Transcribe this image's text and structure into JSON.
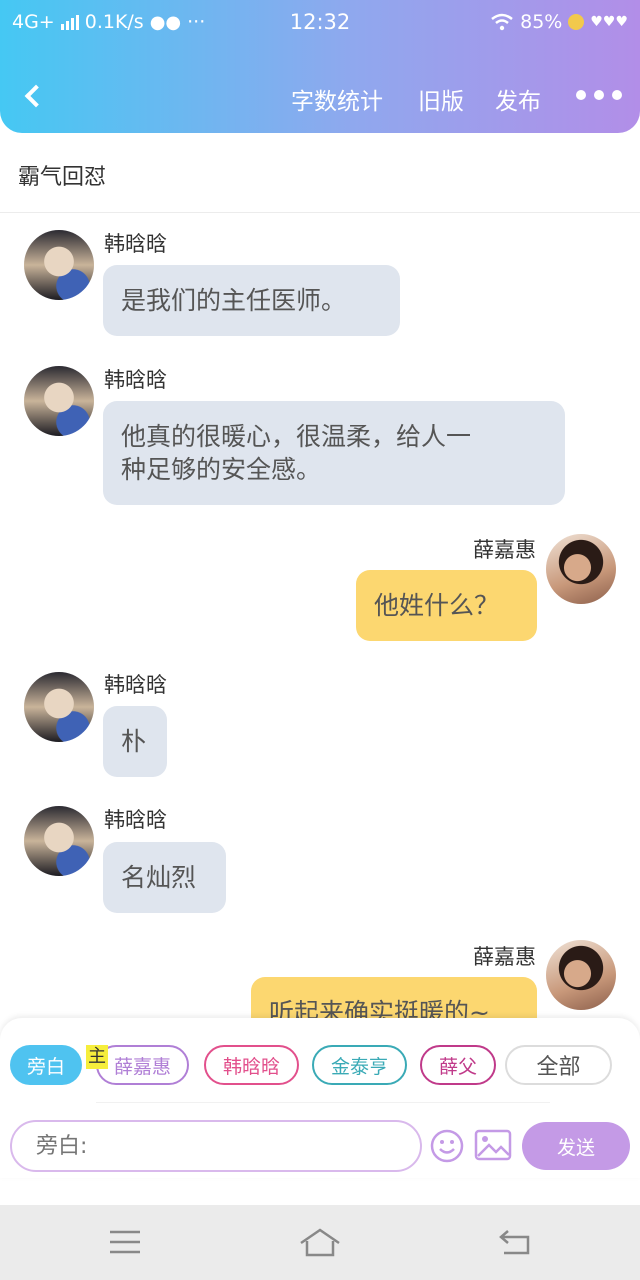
{
  "status_bar": {
    "network": "4G+",
    "speed": "0.1K/s",
    "time": "12:32",
    "battery": "85%"
  },
  "header": {
    "actions": [
      "字数统计",
      "旧版",
      "发布"
    ]
  },
  "title": "霸气回怼",
  "messages": [
    {
      "side": "left",
      "sender": "韩晗晗",
      "lines": [
        "是我们的主任医师。"
      ]
    },
    {
      "side": "left",
      "sender": "韩晗晗",
      "lines": [
        "他真的很暖心，很温柔，给人一",
        "种足够的安全感。"
      ]
    },
    {
      "side": "right",
      "sender": "薛嘉惠",
      "lines": [
        "他姓什么？"
      ]
    },
    {
      "side": "left",
      "sender": "韩晗晗",
      "lines": [
        "朴"
      ]
    },
    {
      "side": "left",
      "sender": "韩晗晗",
      "lines": [
        "名灿烈"
      ]
    },
    {
      "side": "right",
      "sender": "薛嘉惠",
      "lines": [
        "听起来确实挺暖的~"
      ]
    }
  ],
  "characters": {
    "narrator": "旁白",
    "main_badge": "主",
    "list": [
      {
        "name": "薛嘉惠",
        "color": "#b07fd6"
      },
      {
        "name": "韩晗晗",
        "color": "#e2508c"
      },
      {
        "name": "金泰亨",
        "color": "#3aaab6"
      },
      {
        "name": "薛父",
        "color": "#c03a8a"
      }
    ],
    "all": "全部"
  },
  "composer": {
    "placeholder": "旁白:",
    "send": "发送"
  },
  "colors": {
    "accent": "#45c8f3",
    "send": "#c49ae6",
    "bubble_left": "#dfe5ee",
    "bubble_right": "#fcd770"
  },
  "icons": [
    "back-icon",
    "more-icon",
    "emoji-icon",
    "image-icon",
    "menu-icon",
    "home-icon",
    "return-icon"
  ]
}
